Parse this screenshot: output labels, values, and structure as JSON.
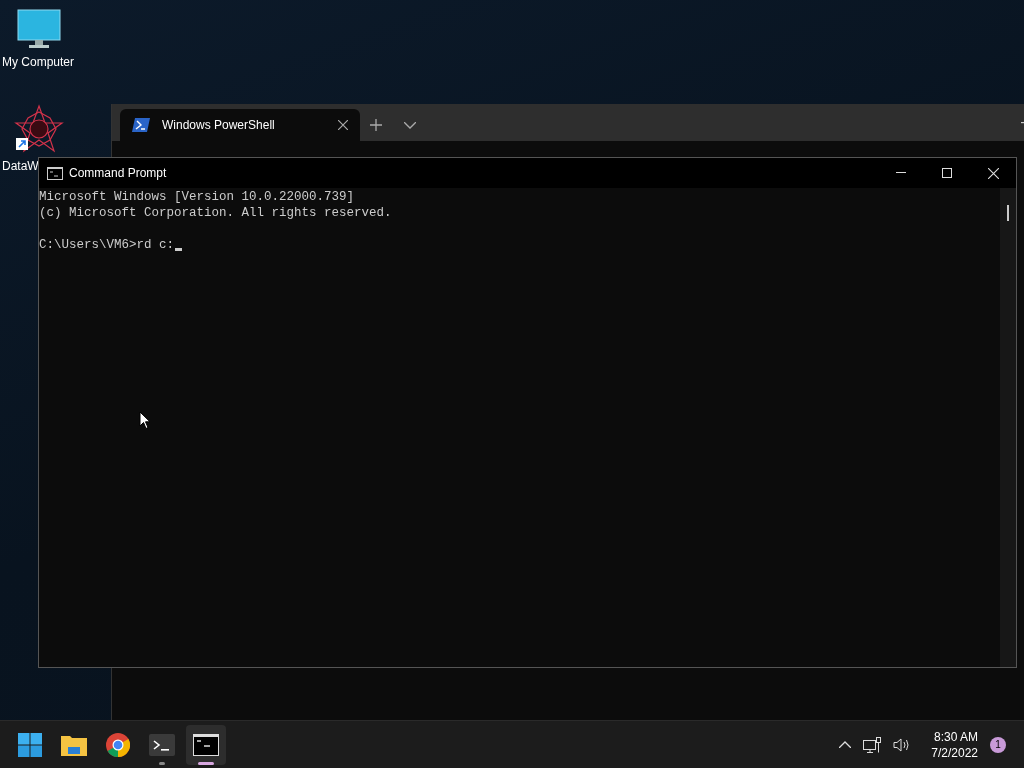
{
  "desktop_icons": [
    {
      "kind": "computer",
      "label": "My Computer"
    },
    {
      "kind": "shortcut",
      "label": "DataW"
    }
  ],
  "powershell_window": {
    "tabs": [
      {
        "label": "Windows PowerShell",
        "selected": true
      }
    ]
  },
  "command_prompt": {
    "title": "Command Prompt",
    "output": [
      "Microsoft Windows [Version 10.0.22000.739]",
      "(c) Microsoft Corporation. All rights reserved."
    ],
    "prompt": "C:\\Users\\VM6>rd c:"
  },
  "taskbar": {
    "apps": [
      {
        "kind": "start",
        "running": false,
        "selected": false
      },
      {
        "kind": "explorer",
        "running": false,
        "selected": false
      },
      {
        "kind": "chrome",
        "running": false,
        "selected": false
      },
      {
        "kind": "terminal",
        "running": true,
        "selected": false
      },
      {
        "kind": "cmd",
        "running": true,
        "selected": true
      }
    ],
    "time": "8:30 AM",
    "date": "7/2/2022",
    "notifications": "1"
  }
}
